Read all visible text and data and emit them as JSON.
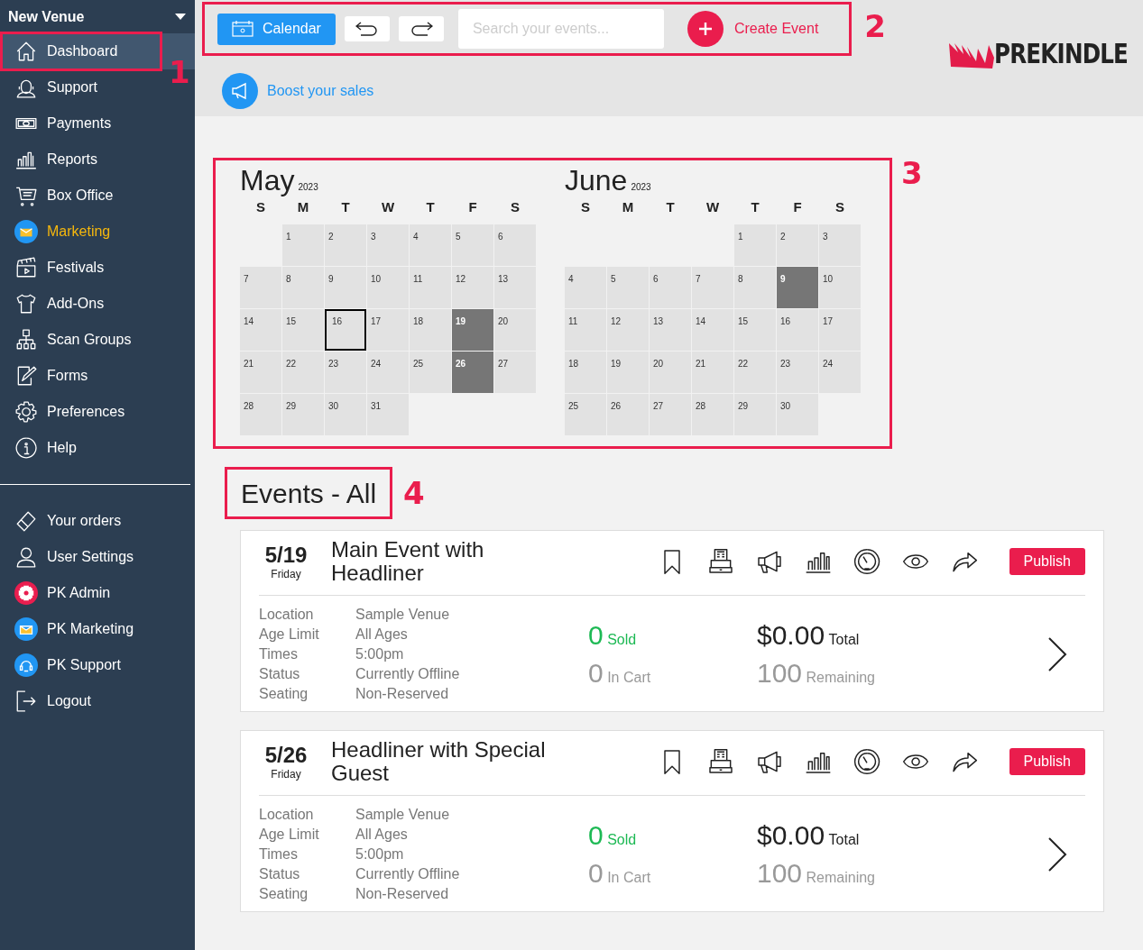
{
  "sidebar": {
    "venue": "New Venue",
    "items": [
      {
        "label": "Dashboard",
        "selected": true,
        "highlighted": false,
        "callout": "1"
      },
      {
        "label": "Support",
        "selected": false,
        "highlighted": false
      },
      {
        "label": "Payments",
        "selected": false,
        "highlighted": false
      },
      {
        "label": "Reports",
        "selected": false,
        "highlighted": false
      },
      {
        "label": "Box Office",
        "selected": false,
        "highlighted": false
      },
      {
        "label": "Marketing",
        "selected": false,
        "highlighted": true
      },
      {
        "label": "Festivals",
        "selected": false,
        "highlighted": false
      },
      {
        "label": "Add-Ons",
        "selected": false,
        "highlighted": false
      },
      {
        "label": "Scan Groups",
        "selected": false,
        "highlighted": false
      },
      {
        "label": "Forms",
        "selected": false,
        "highlighted": false
      },
      {
        "label": "Preferences",
        "selected": false,
        "highlighted": false
      },
      {
        "label": "Help",
        "selected": false,
        "highlighted": false
      }
    ],
    "bottom_items": [
      {
        "label": "Your orders"
      },
      {
        "label": "User Settings"
      },
      {
        "label": "PK Admin"
      },
      {
        "label": "PK Marketing"
      },
      {
        "label": "PK Support"
      },
      {
        "label": "Logout"
      }
    ]
  },
  "toolbar": {
    "calendar_button": "Calendar",
    "search": {
      "placeholder": "Search your events..."
    },
    "create_event": "Create Event",
    "callout": "2"
  },
  "logo": "PREKINDLE",
  "boost_link": "Boost your sales",
  "calendar": {
    "callout": "3",
    "months": [
      {
        "name": "May",
        "year": "2023",
        "weekdays": [
          "S",
          "M",
          "T",
          "W",
          "T",
          "F",
          "S"
        ],
        "days": [
          {
            "kind": "blank"
          },
          {
            "kind": "day",
            "label": "1",
            "event": false,
            "today": false
          },
          {
            "kind": "day",
            "label": "2",
            "event": false,
            "today": false
          },
          {
            "kind": "day",
            "label": "3",
            "event": false,
            "today": false
          },
          {
            "kind": "day",
            "label": "4",
            "event": false,
            "today": false
          },
          {
            "kind": "day",
            "label": "5",
            "event": false,
            "today": false
          },
          {
            "kind": "day",
            "label": "6",
            "event": false,
            "today": false
          },
          {
            "kind": "day",
            "label": "7",
            "event": false,
            "today": false
          },
          {
            "kind": "day",
            "label": "8",
            "event": false,
            "today": false
          },
          {
            "kind": "day",
            "label": "9",
            "event": false,
            "today": false
          },
          {
            "kind": "day",
            "label": "10",
            "event": false,
            "today": false
          },
          {
            "kind": "day",
            "label": "11",
            "event": false,
            "today": false
          },
          {
            "kind": "day",
            "label": "12",
            "event": false,
            "today": false
          },
          {
            "kind": "day",
            "label": "13",
            "event": false,
            "today": false
          },
          {
            "kind": "day",
            "label": "14",
            "event": false,
            "today": false
          },
          {
            "kind": "day",
            "label": "15",
            "event": false,
            "today": false
          },
          {
            "kind": "day",
            "label": "16",
            "event": false,
            "today": true
          },
          {
            "kind": "day",
            "label": "17",
            "event": false,
            "today": false
          },
          {
            "kind": "day",
            "label": "18",
            "event": false,
            "today": false
          },
          {
            "kind": "day",
            "label": "19",
            "event": true,
            "today": false
          },
          {
            "kind": "day",
            "label": "20",
            "event": false,
            "today": false
          },
          {
            "kind": "day",
            "label": "21",
            "event": false,
            "today": false
          },
          {
            "kind": "day",
            "label": "22",
            "event": false,
            "today": false
          },
          {
            "kind": "day",
            "label": "23",
            "event": false,
            "today": false
          },
          {
            "kind": "day",
            "label": "24",
            "event": false,
            "today": false
          },
          {
            "kind": "day",
            "label": "25",
            "event": false,
            "today": false
          },
          {
            "kind": "day",
            "label": "26",
            "event": true,
            "today": false
          },
          {
            "kind": "day",
            "label": "27",
            "event": false,
            "today": false
          },
          {
            "kind": "day",
            "label": "28",
            "event": false,
            "today": false
          },
          {
            "kind": "day",
            "label": "29",
            "event": false,
            "today": false
          },
          {
            "kind": "day",
            "label": "30",
            "event": false,
            "today": false
          },
          {
            "kind": "day",
            "label": "31",
            "event": false,
            "today": false
          }
        ]
      },
      {
        "name": "June",
        "year": "2023",
        "weekdays": [
          "S",
          "M",
          "T",
          "W",
          "T",
          "F",
          "S"
        ],
        "days": [
          {
            "kind": "blank"
          },
          {
            "kind": "blank"
          },
          {
            "kind": "blank"
          },
          {
            "kind": "blank"
          },
          {
            "kind": "day",
            "label": "1",
            "event": false,
            "today": false
          },
          {
            "kind": "day",
            "label": "2",
            "event": false,
            "today": false
          },
          {
            "kind": "day",
            "label": "3",
            "event": false,
            "today": false
          },
          {
            "kind": "day",
            "label": "4",
            "event": false,
            "today": false
          },
          {
            "kind": "day",
            "label": "5",
            "event": false,
            "today": false
          },
          {
            "kind": "day",
            "label": "6",
            "event": false,
            "today": false
          },
          {
            "kind": "day",
            "label": "7",
            "event": false,
            "today": false
          },
          {
            "kind": "day",
            "label": "8",
            "event": false,
            "today": false
          },
          {
            "kind": "day",
            "label": "9",
            "event": true,
            "today": false
          },
          {
            "kind": "day",
            "label": "10",
            "event": false,
            "today": false
          },
          {
            "kind": "day",
            "label": "11",
            "event": false,
            "today": false
          },
          {
            "kind": "day",
            "label": "12",
            "event": false,
            "today": false
          },
          {
            "kind": "day",
            "label": "13",
            "event": false,
            "today": false
          },
          {
            "kind": "day",
            "label": "14",
            "event": false,
            "today": false
          },
          {
            "kind": "day",
            "label": "15",
            "event": false,
            "today": false
          },
          {
            "kind": "day",
            "label": "16",
            "event": false,
            "today": false
          },
          {
            "kind": "day",
            "label": "17",
            "event": false,
            "today": false
          },
          {
            "kind": "day",
            "label": "18",
            "event": false,
            "today": false
          },
          {
            "kind": "day",
            "label": "19",
            "event": false,
            "today": false
          },
          {
            "kind": "day",
            "label": "20",
            "event": false,
            "today": false
          },
          {
            "kind": "day",
            "label": "21",
            "event": false,
            "today": false
          },
          {
            "kind": "day",
            "label": "22",
            "event": false,
            "today": false
          },
          {
            "kind": "day",
            "label": "23",
            "event": false,
            "today": false
          },
          {
            "kind": "day",
            "label": "24",
            "event": false,
            "today": false
          },
          {
            "kind": "day",
            "label": "25",
            "event": false,
            "today": false
          },
          {
            "kind": "day",
            "label": "26",
            "event": false,
            "today": false
          },
          {
            "kind": "day",
            "label": "27",
            "event": false,
            "today": false
          },
          {
            "kind": "day",
            "label": "28",
            "event": false,
            "today": false
          },
          {
            "kind": "day",
            "label": "29",
            "event": false,
            "today": false
          },
          {
            "kind": "day",
            "label": "30",
            "event": false,
            "today": false
          }
        ]
      }
    ]
  },
  "events_heading": {
    "title": "Events - All",
    "callout": "4"
  },
  "events": [
    {
      "date": "5/19",
      "weekday": "Friday",
      "title": "Main Event with Headliner",
      "publish": "Publish",
      "details": [
        {
          "label": "Location",
          "value": "Sample Venue"
        },
        {
          "label": "Age Limit",
          "value": "All Ages"
        },
        {
          "label": "Times",
          "value": "5:00pm"
        },
        {
          "label": "Status",
          "value": "Currently Offline"
        },
        {
          "label": "Seating",
          "value": "Non-Reserved"
        }
      ],
      "sold": "0",
      "sold_label": "Sold",
      "in_cart": "0",
      "in_cart_label": "In Cart",
      "total": "$0.00",
      "total_label": "Total",
      "remaining": "100",
      "remaining_label": "Remaining"
    },
    {
      "date": "5/26",
      "weekday": "Friday",
      "title": "Headliner with Special Guest",
      "publish": "Publish",
      "details": [
        {
          "label": "Location",
          "value": "Sample Venue"
        },
        {
          "label": "Age Limit",
          "value": "All Ages"
        },
        {
          "label": "Times",
          "value": "5:00pm"
        },
        {
          "label": "Status",
          "value": "Currently Offline"
        },
        {
          "label": "Seating",
          "value": "Non-Reserved"
        }
      ],
      "sold": "0",
      "sold_label": "Sold",
      "in_cart": "0",
      "in_cart_label": "In Cart",
      "total": "$0.00",
      "total_label": "Total",
      "remaining": "100",
      "remaining_label": "Remaining"
    }
  ]
}
